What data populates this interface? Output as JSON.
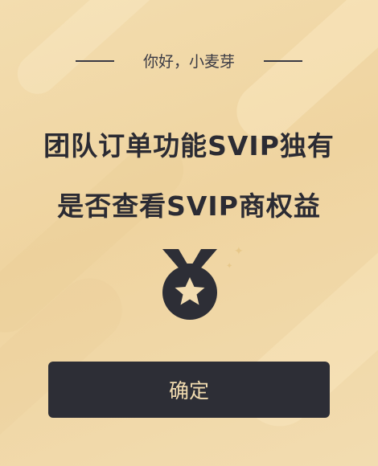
{
  "dialog": {
    "greeting": "你好，小麦芽",
    "title_line1": "团队订单功能SVIP独有",
    "title_line2": "是否查看SVIP商权益",
    "confirm_label": "确定"
  },
  "icons": {
    "medal": "medal-icon",
    "sparkle": "sparkle-icon"
  },
  "colors": {
    "background": "#efd4a0",
    "text_dark": "#2b2b33",
    "button_bg": "#2d2e36",
    "button_text": "#f2dcb0"
  }
}
